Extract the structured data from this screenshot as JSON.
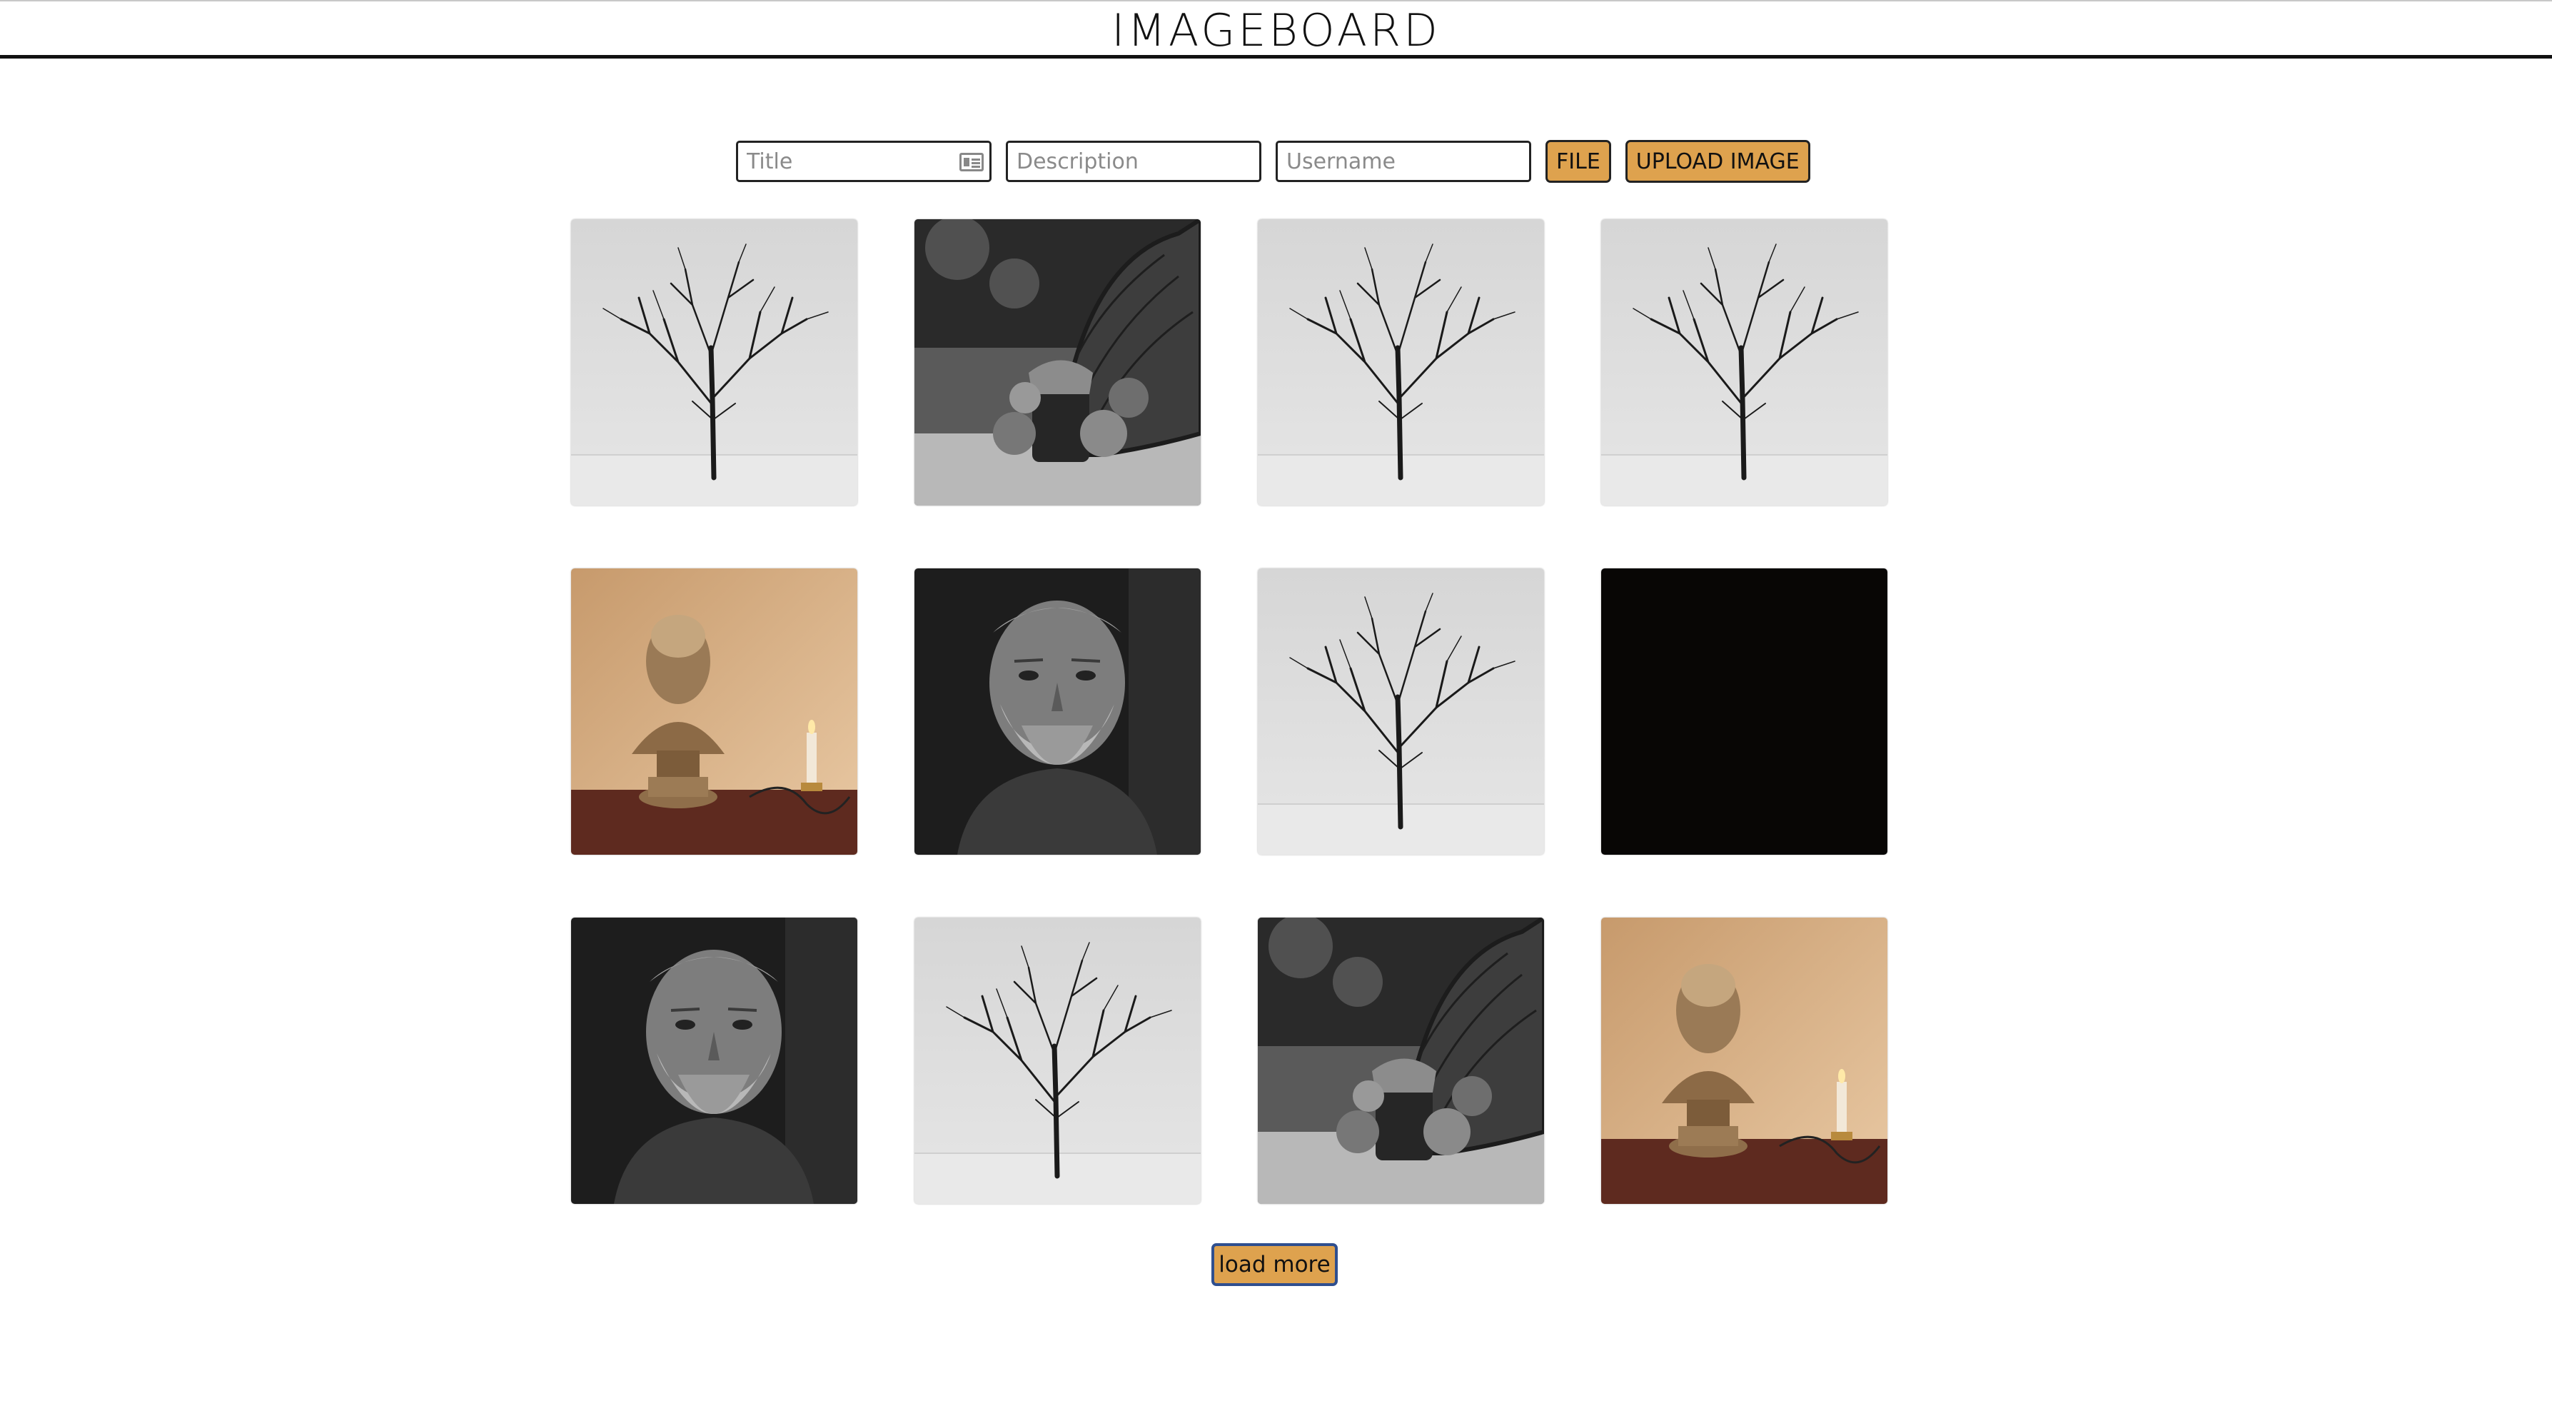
{
  "header": {
    "title": "IMAGEBOARD"
  },
  "upload_form": {
    "title_placeholder": "Title",
    "description_placeholder": "Description",
    "username_placeholder": "Username",
    "file_label": "FILE",
    "upload_label": "UPLOAD IMAGE"
  },
  "gallery": {
    "images": [
      {
        "subject": "bare-tree"
      },
      {
        "subject": "basket-jar"
      },
      {
        "subject": "bare-tree"
      },
      {
        "subject": "bare-tree"
      },
      {
        "subject": "bronze-bust-candle"
      },
      {
        "subject": "bearded-man-portrait"
      },
      {
        "subject": "bare-tree"
      },
      {
        "subject": "black"
      },
      {
        "subject": "bearded-man-portrait"
      },
      {
        "subject": "bare-tree"
      },
      {
        "subject": "basket-jar"
      },
      {
        "subject": "bronze-bust-candle"
      }
    ]
  },
  "load_more_label": "load more",
  "colors": {
    "button": "#dea24e",
    "load_more_border": "#2f4f8f",
    "header_rule": "#111111"
  }
}
